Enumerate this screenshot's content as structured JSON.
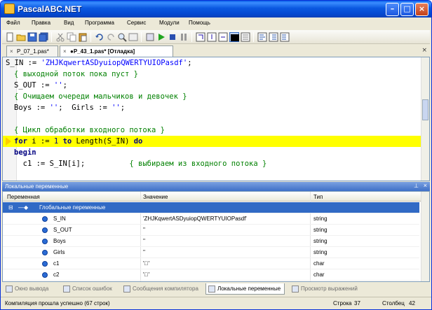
{
  "window": {
    "title": "PascalABC.NET"
  },
  "menu": [
    "Файл",
    "Правка",
    "Вид",
    "Программа",
    "Сервис",
    "Модули",
    "Помощь"
  ],
  "tabs": [
    {
      "label": "P_07_1.pas*",
      "active": false
    },
    {
      "label": "●P_43_1.pas* [Отладка]",
      "active": true
    }
  ],
  "editor": {
    "lines": [
      {
        "parts": [
          [
            "",
            "S_IN := "
          ],
          [
            "str",
            "'ZHJKqwertASDyuiopQWERTYUIOPasdf'"
          ],
          [
            "",
            ";"
          ]
        ]
      },
      {
        "parts": [
          [
            "cm",
            "{ выходной поток пока пуст }"
          ]
        ]
      },
      {
        "parts": [
          [
            "",
            "S_OUT := "
          ],
          [
            "str",
            "''"
          ],
          [
            "",
            ";"
          ]
        ]
      },
      {
        "parts": [
          [
            "cm",
            "{ Очищаем очереди мальчиков и девочек }"
          ]
        ]
      },
      {
        "parts": [
          [
            "",
            "Boys := "
          ],
          [
            "str",
            "''"
          ],
          [
            "",
            ";  Girls := "
          ],
          [
            "str",
            "''"
          ],
          [
            "",
            ";"
          ]
        ]
      },
      {
        "parts": [
          [
            "",
            ""
          ]
        ]
      },
      {
        "parts": [
          [
            "cm",
            "{ Цикл обработки входного потока }"
          ]
        ]
      },
      {
        "parts": [
          [
            "kw",
            "for"
          ],
          [
            "",
            " i := "
          ],
          [
            "num",
            "1"
          ],
          [
            "",
            " "
          ],
          [
            "kw",
            "to"
          ],
          [
            "",
            " Length(S_IN) "
          ],
          [
            "kw",
            "do"
          ]
        ]
      },
      {
        "parts": [
          [
            "kw",
            "begin"
          ]
        ]
      },
      {
        "parts": [
          [
            "",
            "  c1 := S_IN[i];          "
          ],
          [
            "cm",
            "{ выбираем из входного потока }"
          ]
        ]
      }
    ],
    "current_line_index": 7
  },
  "locals_panel": {
    "title": "Локальные переменные",
    "columns": [
      "Переменная",
      "Значение",
      "Тип"
    ],
    "group": "Глобальные переменные",
    "rows": [
      {
        "name": "S_IN",
        "value": "'ZHJKqwertASDyuiopQWERTYUIOPasdf'",
        "type": "string"
      },
      {
        "name": "S_OUT",
        "value": "''",
        "type": "string"
      },
      {
        "name": "Boys",
        "value": "''",
        "type": "string"
      },
      {
        "name": "Girls",
        "value": "''",
        "type": "string"
      },
      {
        "name": "c1",
        "value": "'\u0000'",
        "type": "char"
      },
      {
        "name": "c2",
        "value": "'\u0000'",
        "type": "char"
      }
    ]
  },
  "bottom_tabs": [
    {
      "label": "Окно вывода",
      "active": false
    },
    {
      "label": "Список ошибок",
      "active": false
    },
    {
      "label": "Сообщения компилятора",
      "active": false
    },
    {
      "label": "Локальные переменные",
      "active": true
    },
    {
      "label": "Просмотр выражений",
      "active": false
    }
  ],
  "status": {
    "message": "Компиляция прошла успешно (67 строк)",
    "line_label": "Строка",
    "line_value": "37",
    "col_label": "Столбец",
    "col_value": "42"
  },
  "colors": {
    "highlight": "#ffff00",
    "selection": "#316ac5",
    "titlebar": "#0a58e0"
  }
}
